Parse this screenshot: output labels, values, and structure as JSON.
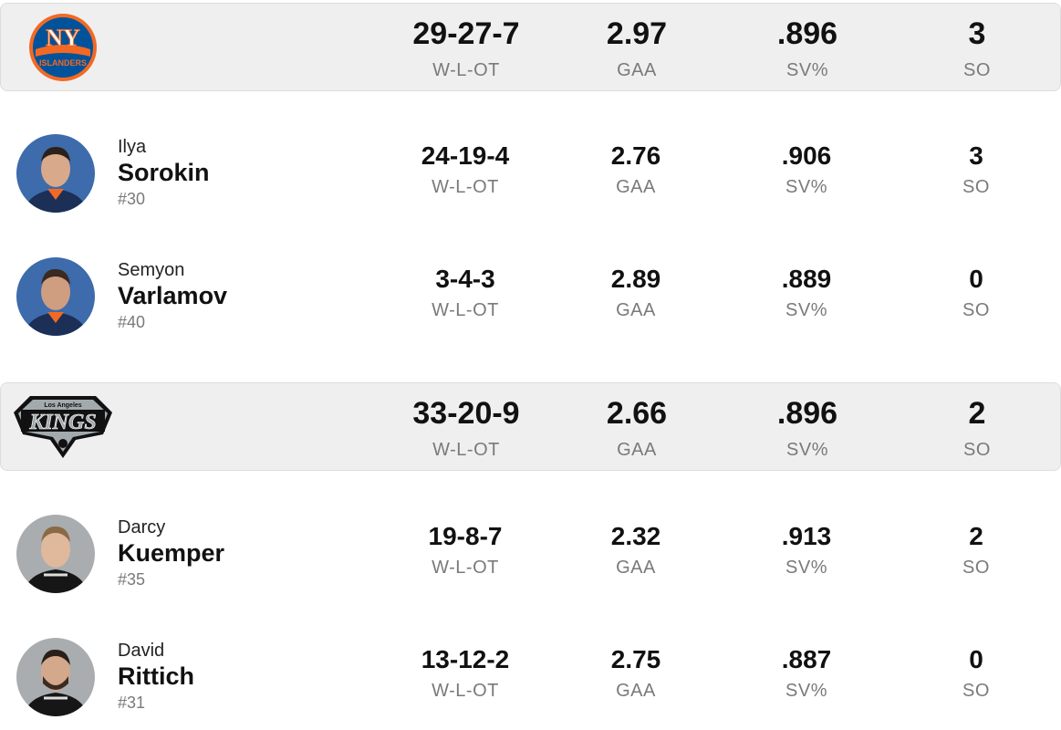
{
  "teams": [
    {
      "abbr": "NY",
      "logo_text": "ISLANDERS",
      "record": "29-27-7",
      "record_label": "W-L-OT",
      "gaa": "2.97",
      "gaa_label": "GAA",
      "sv": ".896",
      "sv_label": "SV%",
      "so": "3",
      "so_label": "SO",
      "colors": {
        "primary": "#f26924",
        "secondary": "#00539b"
      },
      "players": [
        {
          "first": "Ilya",
          "last": "Sorokin",
          "number": "#30",
          "record": "24-19-4",
          "record_label": "W-L-OT",
          "gaa": "2.76",
          "gaa_label": "GAA",
          "sv": ".906",
          "sv_label": "SV%",
          "so": "3",
          "so_label": "SO"
        },
        {
          "first": "Semyon",
          "last": "Varlamov",
          "number": "#40",
          "record": "3-4-3",
          "record_label": "W-L-OT",
          "gaa": "2.89",
          "gaa_label": "GAA",
          "sv": ".889",
          "sv_label": "SV%",
          "so": "0",
          "so_label": "SO"
        }
      ]
    },
    {
      "abbr": "KINGS",
      "logo_text": "Los Angeles",
      "record": "33-20-9",
      "record_label": "W-L-OT",
      "gaa": "2.66",
      "gaa_label": "GAA",
      "sv": ".896",
      "sv_label": "SV%",
      "so": "2",
      "so_label": "SO",
      "colors": {
        "primary": "#111111",
        "secondary": "#a2aaad"
      },
      "players": [
        {
          "first": "Darcy",
          "last": "Kuemper",
          "number": "#35",
          "record": "19-8-7",
          "record_label": "W-L-OT",
          "gaa": "2.32",
          "gaa_label": "GAA",
          "sv": ".913",
          "sv_label": "SV%",
          "so": "2",
          "so_label": "SO"
        },
        {
          "first": "David",
          "last": "Rittich",
          "number": "#31",
          "record": "13-12-2",
          "record_label": "W-L-OT",
          "gaa": "2.75",
          "gaa_label": "GAA",
          "sv": ".887",
          "sv_label": "SV%",
          "so": "0",
          "so_label": "SO"
        }
      ]
    }
  ]
}
